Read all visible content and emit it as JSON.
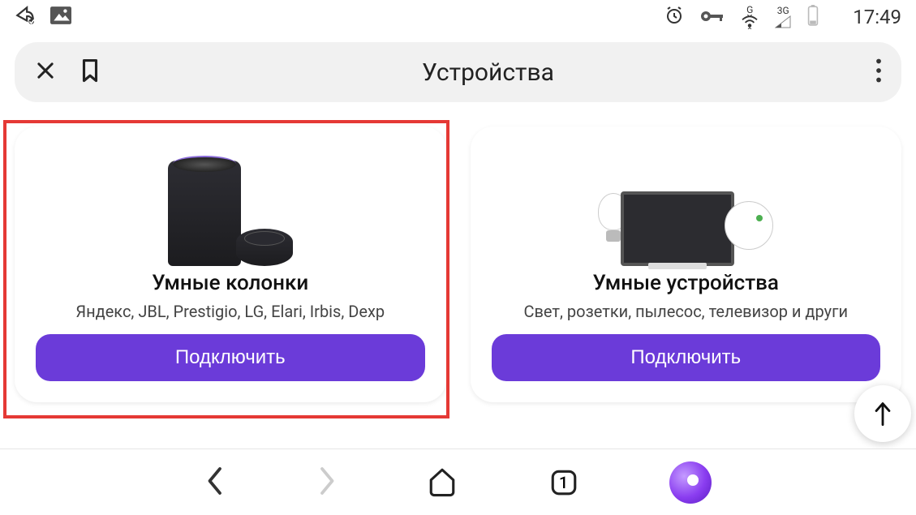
{
  "status": {
    "clock": "17:49",
    "net_g": "G",
    "net_3g": "3G"
  },
  "appbar": {
    "title": "Устройства"
  },
  "cards": [
    {
      "title": "Умные колонки",
      "subtitle": "Яндекс, JBL, Prestigio, LG, Elari, Irbis, Dexp",
      "button": "Подключить"
    },
    {
      "title": "Умные устройства",
      "subtitle": "Свет, розетки, пылесос, телевизор и други",
      "button": "Подключить"
    }
  ],
  "bottomnav": {
    "tab_count": "1"
  }
}
